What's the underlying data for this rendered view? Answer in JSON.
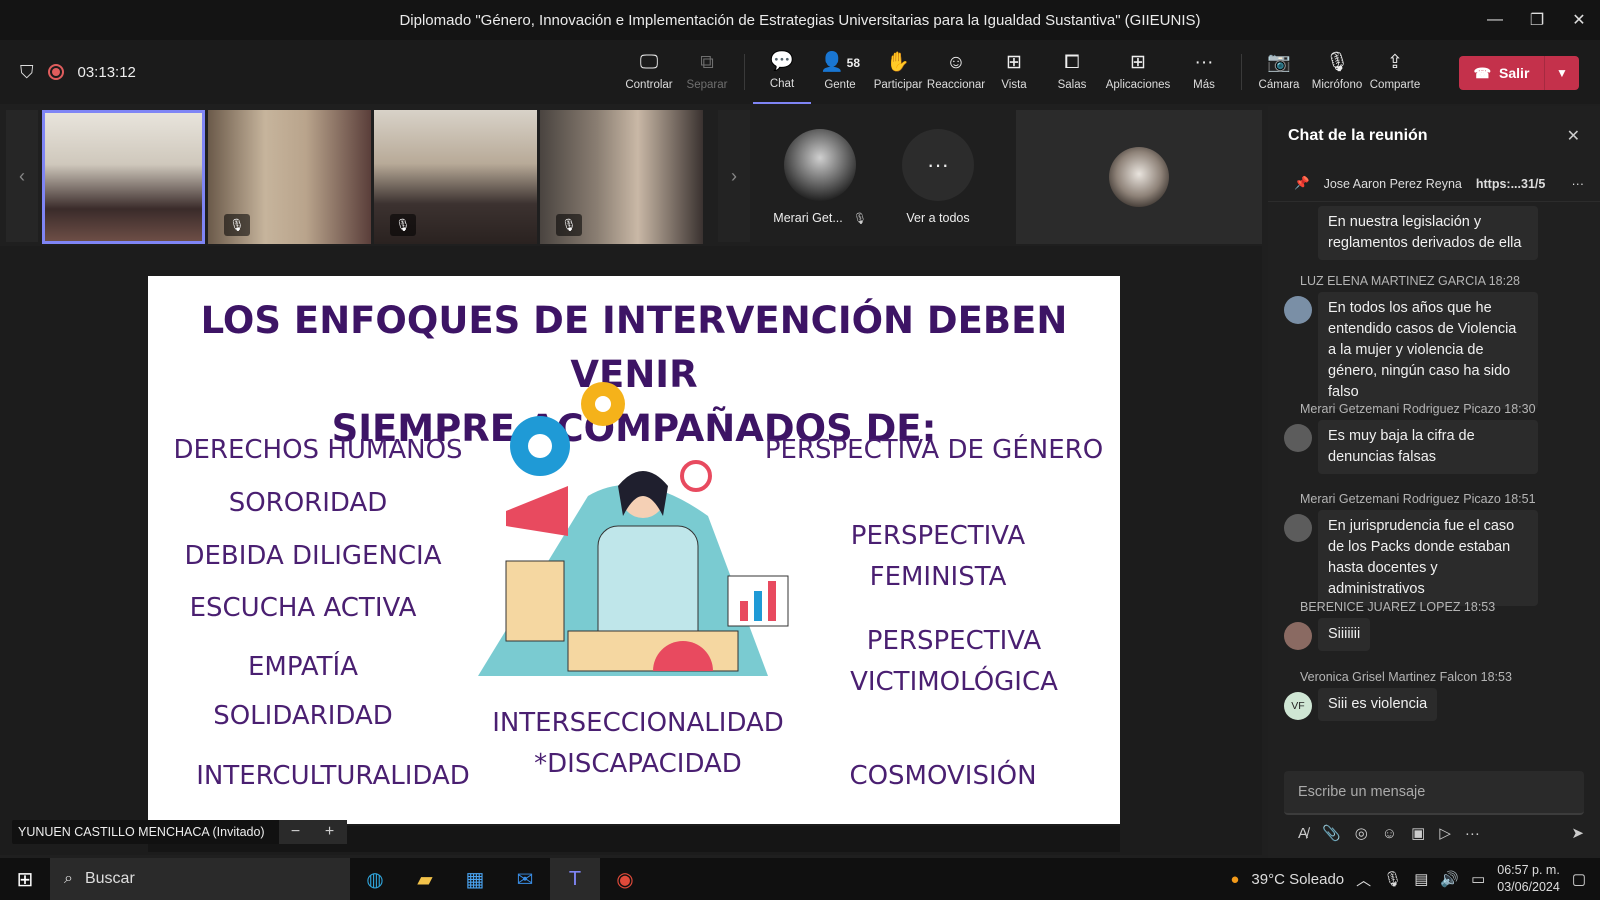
{
  "window": {
    "title": "Diplomado \"Género, Innovación e Implementación de Estrategias Universitarias para la Igualdad Sustantiva\" (GIIEUNIS)"
  },
  "meeting": {
    "timer": "03:13:12"
  },
  "toolbar": {
    "controlar": "Controlar",
    "separar": "Separar",
    "chat": "Chat",
    "gente": "Gente",
    "gente_count": "58",
    "participar": "Participar",
    "reaccionar": "Reaccionar",
    "vista": "Vista",
    "salas": "Salas",
    "aplicaciones": "Aplicaciones",
    "mas": "Más",
    "camara": "Cámara",
    "microfono": "Micrófono",
    "comparte": "Comparte",
    "salir": "Salir"
  },
  "participants": {
    "avatar_name": "Merari Get...",
    "see_all": "Ver a todos"
  },
  "slide": {
    "title_line1": "LOS ENFOQUES DE INTERVENCIÓN DEBEN VENIR",
    "title_line2": "SIEMPRE ACOMPAÑADOS DE:",
    "t1": "DERECHOS HUMANOS",
    "t2": "SORORIDAD",
    "t3": "DEBIDA DILIGENCIA",
    "t4": "ESCUCHA ACTIVA",
    "t5": "EMPATÍA",
    "t6": "SOLIDARIDAD",
    "t7": "INTERCULTURALIDAD",
    "t8": "PERSPECTIVA DE GÉNERO",
    "t9a": "PERSPECTIVA",
    "t9b": "FEMINISTA",
    "t10a": "PERSPECTIVA",
    "t10b": "VICTIMOLÓGICA",
    "t11a": "INTERSECCIONALIDAD",
    "t11b": "*DISCAPACIDAD",
    "t12": "COSMOVISIÓN"
  },
  "presenter": {
    "name": "YUNUEN CASTILLO MENCHACA (Invitado)",
    "zoom_out": "−",
    "zoom_in": "+"
  },
  "chat": {
    "header": "Chat de la reunión",
    "pinned_name": "Jose Aaron Perez Reyna",
    "pinned_link": "https:...31/5",
    "m0_text": "En nuestra legislación y reglamentos  derivados de ella",
    "m1_meta": "LUZ ELENA MARTINEZ GARCIA  18:28",
    "m1_text": "En todos los años que he entendido casos de Violencia a la mujer y violencia de género, ningún caso ha sido falso",
    "m2_meta": "Merari Getzemani Rodriguez Picazo  18:30",
    "m2_text": "Es muy baja la cifra de denuncias falsas",
    "m3_meta": "Merari Getzemani Rodriguez Picazo  18:51",
    "m3_text": "En jurisprudencia fue el caso de los Packs donde estaban hasta docentes y administrativos",
    "m4_meta": "BERENICE JUAREZ LOPEZ  18:53",
    "m4_text": "Siiiiiii",
    "m5_meta": "Veronica Grisel Martinez Falcon  18:53",
    "m5_initials": "VF",
    "m5_text": "Siii es violencia",
    "composer_placeholder": "Escribe un mensaje"
  },
  "taskbar": {
    "search": "Buscar",
    "weather": "39°C  Soleado",
    "time": "06:57 p. m.",
    "date": "03/06/2024"
  }
}
